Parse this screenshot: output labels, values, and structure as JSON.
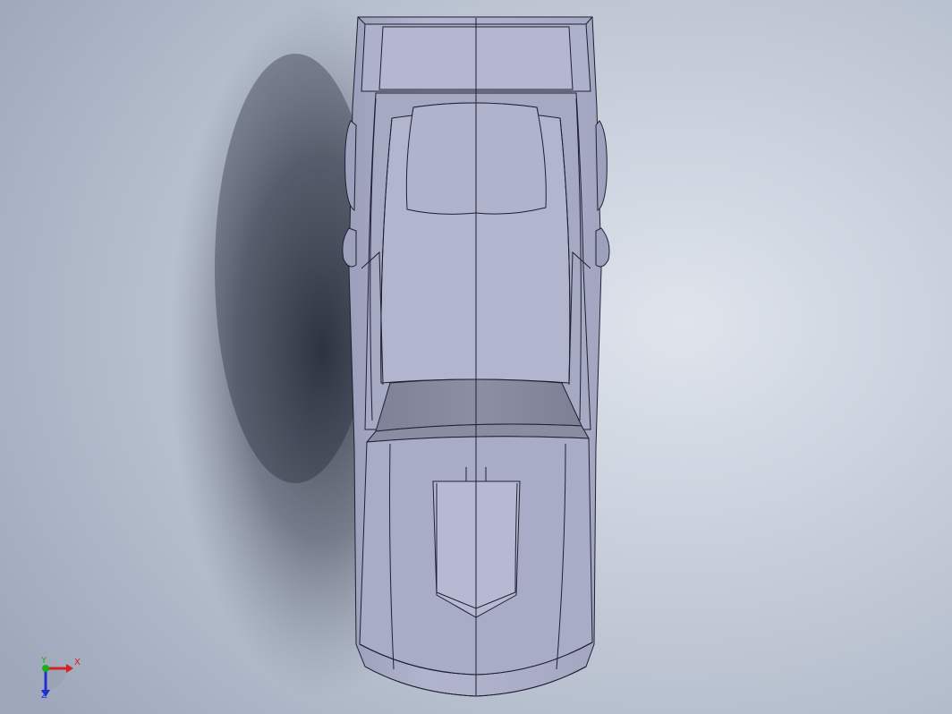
{
  "viewport": {
    "model_name": "car-body-top-view",
    "background_color": "#c9d0dc",
    "model_color": "#a9acc6",
    "edge_color": "#1f1f33"
  },
  "triad": {
    "x_label": "X",
    "y_label": "Y",
    "z_label": "Z",
    "x_color": "#d92020",
    "y_color": "#18b018",
    "z_color": "#2030d0"
  }
}
